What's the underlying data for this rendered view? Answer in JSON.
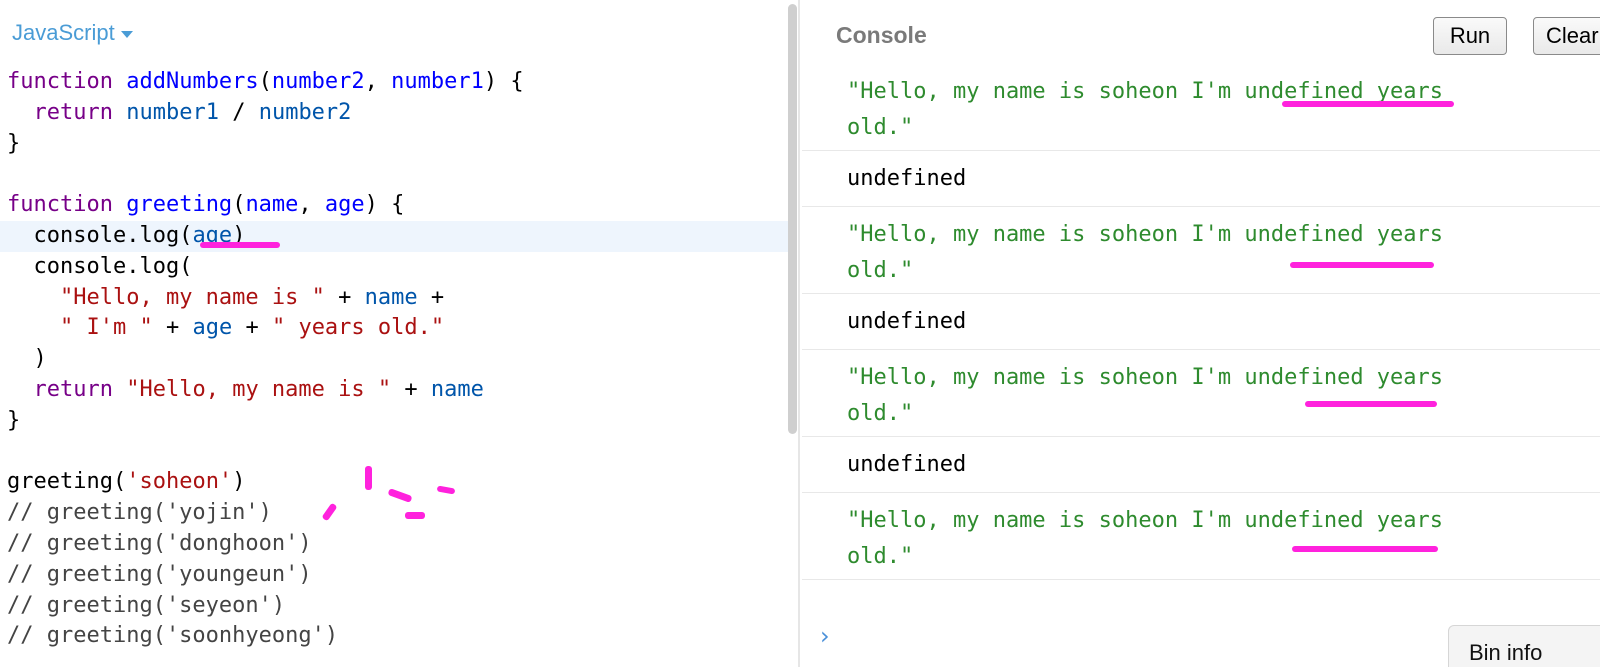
{
  "editor": {
    "language": "JavaScript",
    "lines": [
      [
        {
          "t": "function",
          "c": "keyword"
        },
        {
          "t": " ",
          "c": "plain"
        },
        {
          "t": "addNumbers",
          "c": "def"
        },
        {
          "t": "(",
          "c": "plain"
        },
        {
          "t": "number2",
          "c": "def"
        },
        {
          "t": ", ",
          "c": "plain"
        },
        {
          "t": "number1",
          "c": "def"
        },
        {
          "t": ") {",
          "c": "plain"
        }
      ],
      [
        {
          "t": "  ",
          "c": "plain"
        },
        {
          "t": "return",
          "c": "keyword"
        },
        {
          "t": " ",
          "c": "plain"
        },
        {
          "t": "number1",
          "c": "var"
        },
        {
          "t": " / ",
          "c": "plain"
        },
        {
          "t": "number2",
          "c": "var"
        }
      ],
      [
        {
          "t": "}",
          "c": "plain"
        }
      ],
      [],
      [
        {
          "t": "function",
          "c": "keyword"
        },
        {
          "t": " ",
          "c": "plain"
        },
        {
          "t": "greeting",
          "c": "def"
        },
        {
          "t": "(",
          "c": "plain"
        },
        {
          "t": "name",
          "c": "def"
        },
        {
          "t": ", ",
          "c": "plain"
        },
        {
          "t": "age",
          "c": "def"
        },
        {
          "t": ") {",
          "c": "plain"
        }
      ],
      [
        {
          "t": "  console.log(",
          "c": "plain"
        },
        {
          "t": "age",
          "c": "var"
        },
        {
          "t": ")",
          "c": "plain"
        }
      ],
      [
        {
          "t": "  console.log(",
          "c": "plain"
        }
      ],
      [
        {
          "t": "    ",
          "c": "plain"
        },
        {
          "t": "\"Hello, my name is \"",
          "c": "string"
        },
        {
          "t": " + ",
          "c": "plain"
        },
        {
          "t": "name",
          "c": "var"
        },
        {
          "t": " +",
          "c": "plain"
        }
      ],
      [
        {
          "t": "    ",
          "c": "plain"
        },
        {
          "t": "\" I'm \"",
          "c": "string"
        },
        {
          "t": " + ",
          "c": "plain"
        },
        {
          "t": "age",
          "c": "var"
        },
        {
          "t": " + ",
          "c": "plain"
        },
        {
          "t": "\" years old.\"",
          "c": "string"
        }
      ],
      [
        {
          "t": "  )",
          "c": "plain"
        }
      ],
      [
        {
          "t": "  ",
          "c": "plain"
        },
        {
          "t": "return",
          "c": "keyword"
        },
        {
          "t": " ",
          "c": "plain"
        },
        {
          "t": "\"Hello, my name is \"",
          "c": "string"
        },
        {
          "t": " + ",
          "c": "plain"
        },
        {
          "t": "name",
          "c": "var"
        }
      ],
      [
        {
          "t": "}",
          "c": "plain"
        }
      ],
      [],
      [
        {
          "t": "greeting(",
          "c": "plain"
        },
        {
          "t": "'soheon'",
          "c": "string"
        },
        {
          "t": ")",
          "c": "plain"
        }
      ],
      [
        {
          "t": "// greeting('yojin')",
          "c": "comment"
        }
      ],
      [
        {
          "t": "// greeting('donghoon')",
          "c": "comment"
        }
      ],
      [
        {
          "t": "// greeting('youngeun')",
          "c": "comment"
        }
      ],
      [
        {
          "t": "// greeting('seyeon')",
          "c": "comment"
        }
      ],
      [
        {
          "t": "// greeting('soonhyeong')",
          "c": "comment"
        }
      ]
    ]
  },
  "console": {
    "title": "Console",
    "run_label": "Run",
    "clear_label": "Clear",
    "entries": [
      {
        "kind": "str",
        "line1": "\"Hello, my name is soheon I'm undefined years",
        "line2": "old.\""
      },
      {
        "kind": "undef",
        "text": "undefined"
      },
      {
        "kind": "str",
        "line1": "\"Hello, my name is soheon I'm undefined years",
        "line2": "old.\""
      },
      {
        "kind": "undef",
        "text": "undefined"
      },
      {
        "kind": "str",
        "line1": "\"Hello, my name is soheon I'm undefined years",
        "line2": "old.\""
      },
      {
        "kind": "undef",
        "text": "undefined"
      },
      {
        "kind": "str",
        "line1": "\"Hello, my name is soheon I'm undefined years",
        "line2": "old.\""
      }
    ],
    "prompt_symbol": "›",
    "bin_info_label": "Bin info"
  },
  "colors": {
    "annotation": "#ff22dd",
    "link_blue": "#4a9cd6",
    "console_string": "#2e8b2e"
  }
}
